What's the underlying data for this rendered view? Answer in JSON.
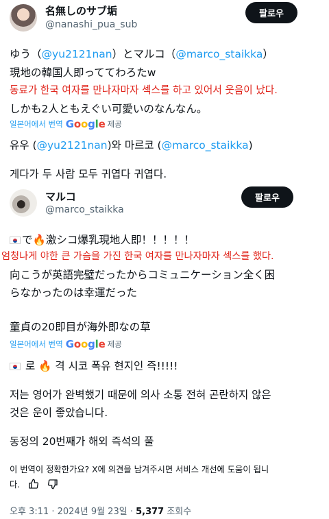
{
  "tweet1": {
    "user_name": "名無しのサブ垢",
    "handle": "@nanashi_pua_sub",
    "follow_label": "팔로우",
    "line1_pre": "ゆう（",
    "line1_link1": "@yu2121nan",
    "line1_mid": "）とマルコ（",
    "line1_link2": "@marco_staikka",
    "line1_post": "）",
    "line2": "現地の韓国人即っててわろたw",
    "red_translation": "동료가 한국 여자를 만나자마자 섹스를 하고 있어서 웃음이 났다.",
    "line3": "しかも2人ともえぐい可愛いのなんなん。",
    "translated_by": "일본어에서 번역",
    "google": "Google",
    "provider": "제공",
    "tr_line1_pre": "유우 (",
    "tr_line1_link1": "@yu2121nan",
    "tr_line1_mid": ")와 마르코 (",
    "tr_line1_link2": "@marco_staikka",
    "tr_line1_post": ")",
    "tr_line2": "게다가 두 사람 모두 귀엽다 귀엽다."
  },
  "tweet2": {
    "user_name": "マルコ",
    "handle": "@marco_staikka",
    "follow_label": "팔로우",
    "line1_a": "で",
    "line1_b": "激シコ爆乳現地人即！！！！！",
    "red_translation": "엄청나게 야한 큰 가슴을 가진 한국 여자를 만나자마자 섹스를 했다.",
    "line2a": "向こうが英語完璧だったからコミュニケーション全く困",
    "line2b": "らなかったのは幸運だった",
    "line3": "童貞の20即目が海外即なの草",
    "translated_by": "일본어에서 번역",
    "google": "Google",
    "provider": "제공",
    "tr_line1_a": "로",
    "tr_line1_b": "격 시코 폭유 현지인 즉!!!!!",
    "tr_line2a": "저는 영어가 완벽했기 때문에 의사 소통 전혀 곤란하지 않은",
    "tr_line2b": "것은 운이 좋았습니다.",
    "tr_line3": "동정의 20번째가 해외 즉석의 풀",
    "feedback_a": "이 번역이 정확한가요? X에 의견을 남겨주시면 서비스 개선에 도움이 됩니",
    "feedback_b": "다.",
    "timestamp": "오후 3:11 · 2024년 9월 23일 · ",
    "views_count": "5,377",
    "views_label": " 조회수"
  },
  "colors": {
    "link": "#1d9bf0",
    "red_overlay": "#e0241b",
    "button": "#0f1419"
  },
  "icons": [
    "korean-flag-icon",
    "fire-icon",
    "google-logo",
    "thumbs-up-icon",
    "thumbs-down-icon"
  ]
}
